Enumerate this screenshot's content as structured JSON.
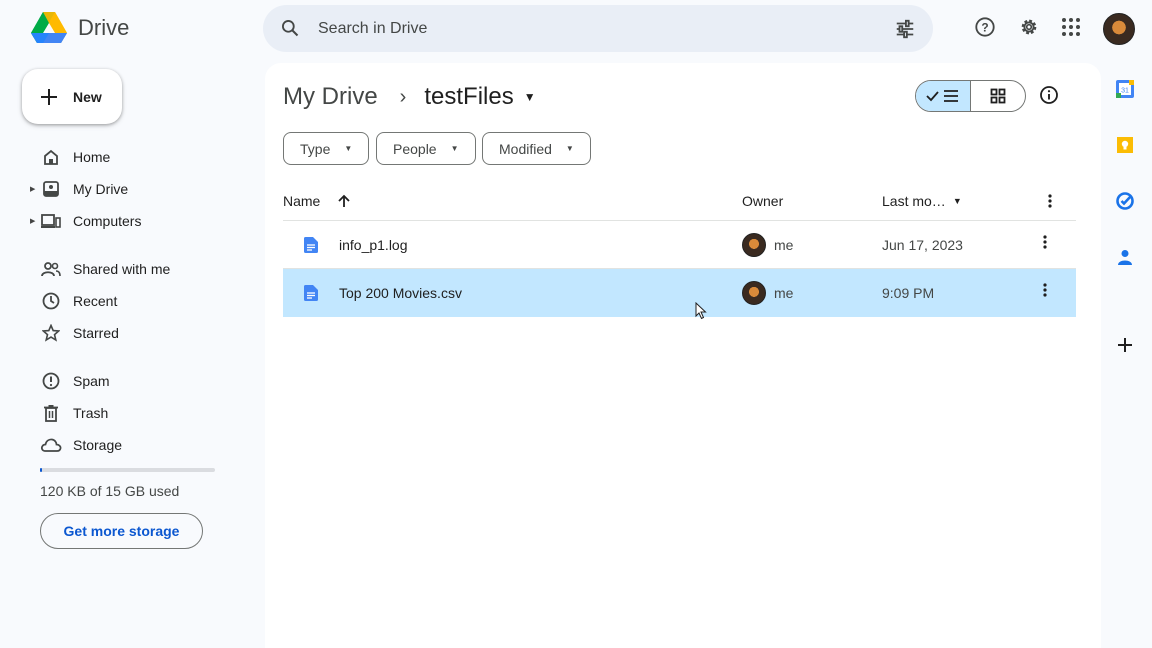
{
  "app": {
    "name": "Drive"
  },
  "search": {
    "placeholder": "Search in Drive"
  },
  "sidebar": {
    "new_label": "New",
    "items": [
      {
        "label": "Home"
      },
      {
        "label": "My Drive"
      },
      {
        "label": "Computers"
      },
      {
        "label": "Shared with me"
      },
      {
        "label": "Recent"
      },
      {
        "label": "Starred"
      },
      {
        "label": "Spam"
      },
      {
        "label": "Trash"
      },
      {
        "label": "Storage"
      }
    ],
    "storage_text": "120 KB of 15 GB used",
    "storage_fraction": 0.01,
    "get_storage_label": "Get more storage"
  },
  "breadcrumb": {
    "root": "My Drive",
    "current": "testFiles"
  },
  "filters": [
    "Type",
    "People",
    "Modified"
  ],
  "table": {
    "columns": {
      "name": "Name",
      "owner": "Owner",
      "modified": "Last mo…"
    },
    "rows": [
      {
        "name": "info_p1.log",
        "owner": "me",
        "modified": "Jun 17, 2023",
        "selected": false
      },
      {
        "name": "Top 200 Movies.csv",
        "owner": "me",
        "modified": "9:09 PM",
        "selected": true
      }
    ]
  },
  "colors": {
    "accent": "#0b57d0",
    "selected_row": "#c2e7ff",
    "main_bg": "#ffffff",
    "page_bg": "#f8fafd",
    "doc_icon": "#4285f4"
  }
}
